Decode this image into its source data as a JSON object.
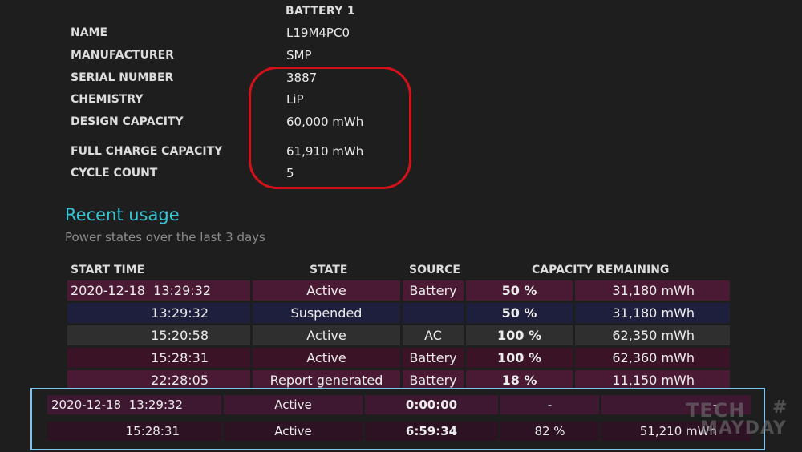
{
  "battery": {
    "header": "BATTERY 1",
    "fields": [
      {
        "label": "NAME",
        "value": "L19M4PC0"
      },
      {
        "label": "MANUFACTURER",
        "value": "SMP"
      },
      {
        "label": "SERIAL NUMBER",
        "value": "3887"
      },
      {
        "label": "CHEMISTRY",
        "value": "LiP"
      },
      {
        "label": "DESIGN CAPACITY",
        "value": "60,000 mWh"
      },
      {
        "label": "FULL CHARGE CAPACITY",
        "value": "61,910 mWh"
      },
      {
        "label": "CYCLE COUNT",
        "value": "5"
      }
    ]
  },
  "recent_usage": {
    "title": "Recent usage",
    "subtitle": "Power states over the last 3 days",
    "columns": [
      "START TIME",
      "STATE",
      "SOURCE",
      "CAPACITY REMAINING"
    ],
    "rows": [
      {
        "date": "2020-12-18",
        "time": "13:29:32",
        "state": "Active",
        "source": "Battery",
        "percent": "50 %",
        "mwh": "31,180 mWh"
      },
      {
        "date": "",
        "time": "13:29:32",
        "state": "Suspended",
        "source": "",
        "percent": "50 %",
        "mwh": "31,180 mWh"
      },
      {
        "date": "",
        "time": "15:20:58",
        "state": "Active",
        "source": "AC",
        "percent": "100 %",
        "mwh": "62,350 mWh"
      },
      {
        "date": "",
        "time": "15:28:31",
        "state": "Active",
        "source": "Battery",
        "percent": "100 %",
        "mwh": "62,360 mWh"
      },
      {
        "date": "",
        "time": "22:28:05",
        "state": "Report generated",
        "source": "Battery",
        "percent": "18 %",
        "mwh": "11,150 mWh"
      }
    ]
  },
  "battery_usage_overlay": {
    "rows": [
      {
        "date": "2020-12-18",
        "time": "13:29:32",
        "state": "Active",
        "duration": "0:00:00",
        "percent": "-",
        "mwh": "-"
      },
      {
        "date": "",
        "time": "15:28:31",
        "state": "Active",
        "duration": "6:59:34",
        "percent": "82 %",
        "mwh": "51,210 mWh"
      }
    ]
  },
  "watermark": {
    "line1": "TECH",
    "line2": "MAYDAY",
    "symbol": "#"
  },
  "colors": {
    "accent": "#33c6d6",
    "highlight": "#d4111a",
    "overlay_border": "#7cc6ee"
  }
}
